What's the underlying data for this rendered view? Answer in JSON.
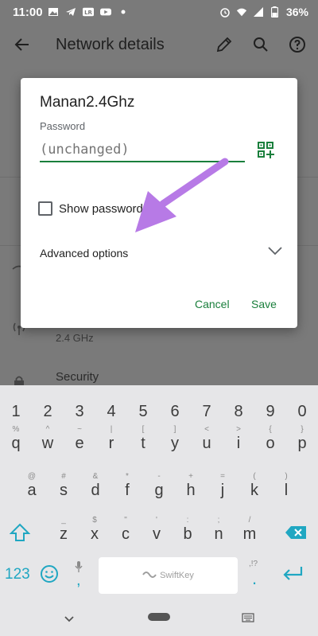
{
  "status_bar": {
    "time": "11:00",
    "battery": "36%",
    "icons": [
      "image-icon",
      "telegram-icon",
      "lr-icon",
      "youtube-icon",
      "dot-icon",
      "alarm-icon",
      "wifi-icon",
      "signal-icon",
      "battery-icon"
    ]
  },
  "appbar": {
    "title": "Network details"
  },
  "background": {
    "frequency": "2.4 GHz",
    "security_label": "Security"
  },
  "dialog": {
    "title": "Manan2.4Ghz",
    "password_label": "Password",
    "password_placeholder": "(unchanged)",
    "show_password_label": "Show password",
    "advanced_label": "Advanced options",
    "cancel_label": "Cancel",
    "save_label": "Save"
  },
  "colors": {
    "accent": "#1a7f3c",
    "keyboard_accent": "#20a7c2",
    "arrow": "#b77ae6"
  },
  "keyboard": {
    "numbers": [
      "1",
      "2",
      "3",
      "4",
      "5",
      "6",
      "7",
      "8",
      "9",
      "0"
    ],
    "row1": [
      {
        "k": "q",
        "s": "%"
      },
      {
        "k": "w",
        "s": "^"
      },
      {
        "k": "e",
        "s": "~"
      },
      {
        "k": "r",
        "s": "|"
      },
      {
        "k": "t",
        "s": "["
      },
      {
        "k": "y",
        "s": "]"
      },
      {
        "k": "u",
        "s": "<"
      },
      {
        "k": "i",
        "s": ">"
      },
      {
        "k": "o",
        "s": "{"
      },
      {
        "k": "p",
        "s": "}"
      }
    ],
    "row2": [
      {
        "k": "a",
        "s": "@"
      },
      {
        "k": "s",
        "s": "#"
      },
      {
        "k": "d",
        "s": "&"
      },
      {
        "k": "f",
        "s": "*"
      },
      {
        "k": "g",
        "s": "-"
      },
      {
        "k": "h",
        "s": "+"
      },
      {
        "k": "j",
        "s": "="
      },
      {
        "k": "k",
        "s": "("
      },
      {
        "k": "l",
        "s": ")"
      }
    ],
    "row3": [
      {
        "k": "z",
        "s": "_"
      },
      {
        "k": "x",
        "s": "$"
      },
      {
        "k": "c",
        "s": "\""
      },
      {
        "k": "v",
        "s": "'"
      },
      {
        "k": "b",
        "s": ":"
      },
      {
        "k": "n",
        "s": ";"
      },
      {
        "k": "m",
        "s": "/"
      }
    ],
    "symbols_key": "123",
    "comma": ",",
    "period": ".",
    "period_sub": ",!?",
    "space_label": "SwiftKey"
  }
}
